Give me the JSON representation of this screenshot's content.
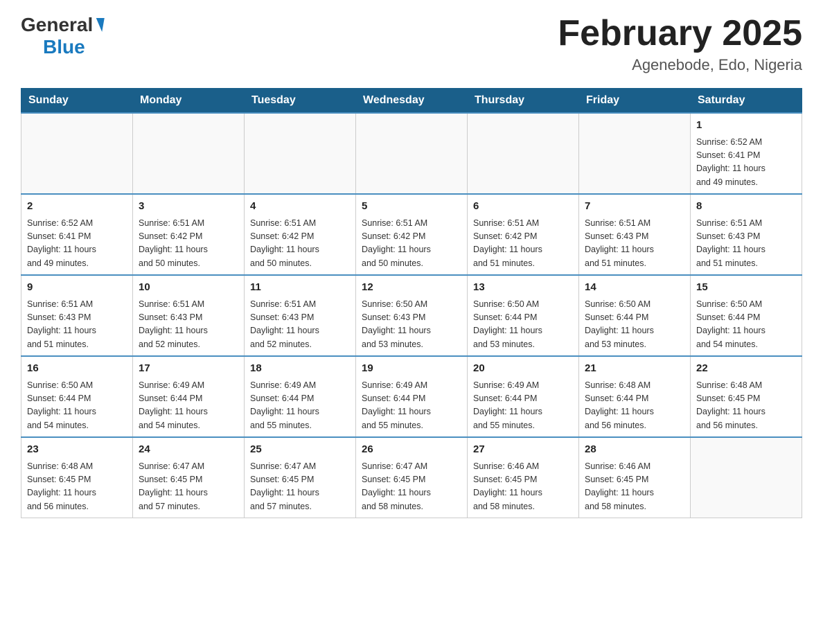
{
  "header": {
    "logo_general": "General",
    "logo_blue": "Blue",
    "month_title": "February 2025",
    "location": "Agenebode, Edo, Nigeria"
  },
  "weekdays": [
    "Sunday",
    "Monday",
    "Tuesday",
    "Wednesday",
    "Thursday",
    "Friday",
    "Saturday"
  ],
  "weeks": [
    [
      {
        "day": "",
        "info": ""
      },
      {
        "day": "",
        "info": ""
      },
      {
        "day": "",
        "info": ""
      },
      {
        "day": "",
        "info": ""
      },
      {
        "day": "",
        "info": ""
      },
      {
        "day": "",
        "info": ""
      },
      {
        "day": "1",
        "info": "Sunrise: 6:52 AM\nSunset: 6:41 PM\nDaylight: 11 hours\nand 49 minutes."
      }
    ],
    [
      {
        "day": "2",
        "info": "Sunrise: 6:52 AM\nSunset: 6:41 PM\nDaylight: 11 hours\nand 49 minutes."
      },
      {
        "day": "3",
        "info": "Sunrise: 6:51 AM\nSunset: 6:42 PM\nDaylight: 11 hours\nand 50 minutes."
      },
      {
        "day": "4",
        "info": "Sunrise: 6:51 AM\nSunset: 6:42 PM\nDaylight: 11 hours\nand 50 minutes."
      },
      {
        "day": "5",
        "info": "Sunrise: 6:51 AM\nSunset: 6:42 PM\nDaylight: 11 hours\nand 50 minutes."
      },
      {
        "day": "6",
        "info": "Sunrise: 6:51 AM\nSunset: 6:42 PM\nDaylight: 11 hours\nand 51 minutes."
      },
      {
        "day": "7",
        "info": "Sunrise: 6:51 AM\nSunset: 6:43 PM\nDaylight: 11 hours\nand 51 minutes."
      },
      {
        "day": "8",
        "info": "Sunrise: 6:51 AM\nSunset: 6:43 PM\nDaylight: 11 hours\nand 51 minutes."
      }
    ],
    [
      {
        "day": "9",
        "info": "Sunrise: 6:51 AM\nSunset: 6:43 PM\nDaylight: 11 hours\nand 51 minutes."
      },
      {
        "day": "10",
        "info": "Sunrise: 6:51 AM\nSunset: 6:43 PM\nDaylight: 11 hours\nand 52 minutes."
      },
      {
        "day": "11",
        "info": "Sunrise: 6:51 AM\nSunset: 6:43 PM\nDaylight: 11 hours\nand 52 minutes."
      },
      {
        "day": "12",
        "info": "Sunrise: 6:50 AM\nSunset: 6:43 PM\nDaylight: 11 hours\nand 53 minutes."
      },
      {
        "day": "13",
        "info": "Sunrise: 6:50 AM\nSunset: 6:44 PM\nDaylight: 11 hours\nand 53 minutes."
      },
      {
        "day": "14",
        "info": "Sunrise: 6:50 AM\nSunset: 6:44 PM\nDaylight: 11 hours\nand 53 minutes."
      },
      {
        "day": "15",
        "info": "Sunrise: 6:50 AM\nSunset: 6:44 PM\nDaylight: 11 hours\nand 54 minutes."
      }
    ],
    [
      {
        "day": "16",
        "info": "Sunrise: 6:50 AM\nSunset: 6:44 PM\nDaylight: 11 hours\nand 54 minutes."
      },
      {
        "day": "17",
        "info": "Sunrise: 6:49 AM\nSunset: 6:44 PM\nDaylight: 11 hours\nand 54 minutes."
      },
      {
        "day": "18",
        "info": "Sunrise: 6:49 AM\nSunset: 6:44 PM\nDaylight: 11 hours\nand 55 minutes."
      },
      {
        "day": "19",
        "info": "Sunrise: 6:49 AM\nSunset: 6:44 PM\nDaylight: 11 hours\nand 55 minutes."
      },
      {
        "day": "20",
        "info": "Sunrise: 6:49 AM\nSunset: 6:44 PM\nDaylight: 11 hours\nand 55 minutes."
      },
      {
        "day": "21",
        "info": "Sunrise: 6:48 AM\nSunset: 6:44 PM\nDaylight: 11 hours\nand 56 minutes."
      },
      {
        "day": "22",
        "info": "Sunrise: 6:48 AM\nSunset: 6:45 PM\nDaylight: 11 hours\nand 56 minutes."
      }
    ],
    [
      {
        "day": "23",
        "info": "Sunrise: 6:48 AM\nSunset: 6:45 PM\nDaylight: 11 hours\nand 56 minutes."
      },
      {
        "day": "24",
        "info": "Sunrise: 6:47 AM\nSunset: 6:45 PM\nDaylight: 11 hours\nand 57 minutes."
      },
      {
        "day": "25",
        "info": "Sunrise: 6:47 AM\nSunset: 6:45 PM\nDaylight: 11 hours\nand 57 minutes."
      },
      {
        "day": "26",
        "info": "Sunrise: 6:47 AM\nSunset: 6:45 PM\nDaylight: 11 hours\nand 58 minutes."
      },
      {
        "day": "27",
        "info": "Sunrise: 6:46 AM\nSunset: 6:45 PM\nDaylight: 11 hours\nand 58 minutes."
      },
      {
        "day": "28",
        "info": "Sunrise: 6:46 AM\nSunset: 6:45 PM\nDaylight: 11 hours\nand 58 minutes."
      },
      {
        "day": "",
        "info": ""
      }
    ]
  ]
}
